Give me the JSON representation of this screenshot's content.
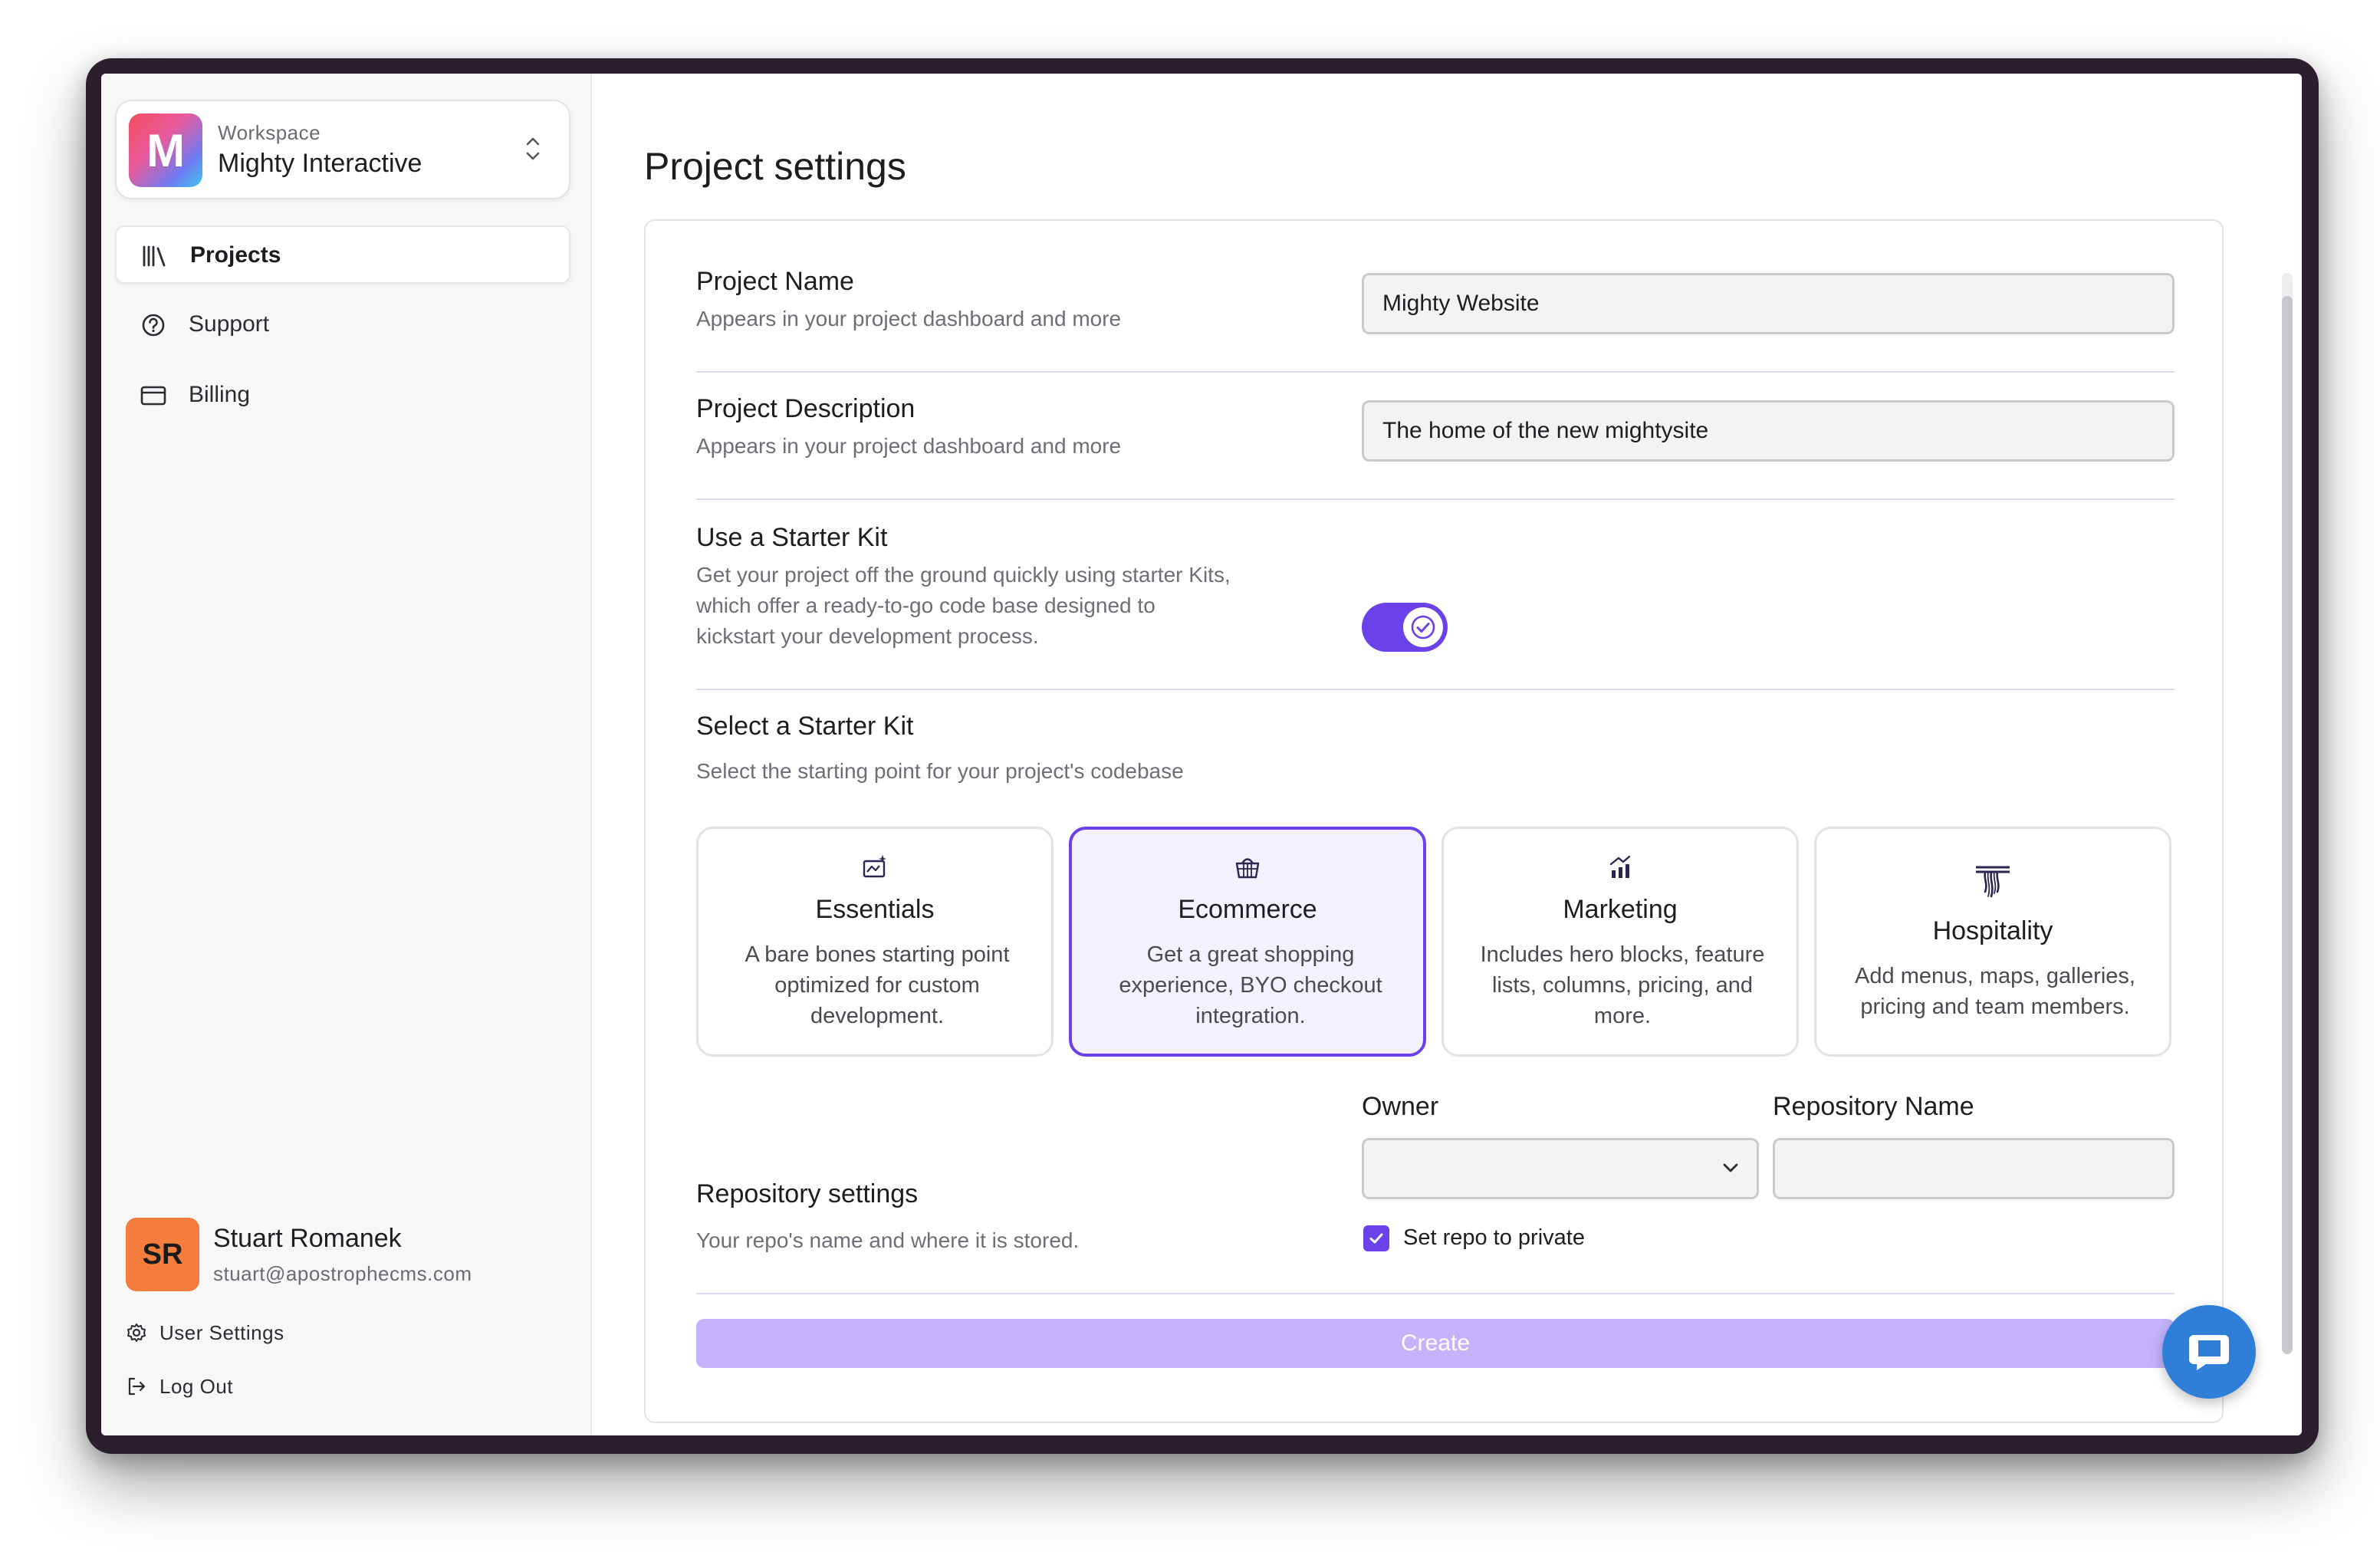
{
  "workspace": {
    "caption": "Workspace",
    "name": "Mighty Interactive",
    "logo_letter": "M"
  },
  "nav": {
    "items": [
      {
        "label": "Projects",
        "icon": "library-icon",
        "active": true
      },
      {
        "label": "Support",
        "icon": "help-circle-icon",
        "active": false
      },
      {
        "label": "Billing",
        "icon": "credit-card-icon",
        "active": false
      }
    ]
  },
  "user": {
    "initials": "SR",
    "name": "Stuart Romanek",
    "email": "stuart@apostrophecms.com",
    "settings_label": "User Settings",
    "logout_label": "Log Out"
  },
  "page": {
    "title": "Project settings"
  },
  "form": {
    "project_name": {
      "title": "Project Name",
      "description": "Appears in your project dashboard and more",
      "value": "Mighty Website"
    },
    "project_description": {
      "title": "Project Description",
      "description": "Appears in your project dashboard and more",
      "value": "The home of the new mightysite"
    },
    "starter_kit_toggle": {
      "title": "Use a Starter Kit",
      "description_lines": [
        "Get your project off the ground quickly using starter Kits,",
        "which offer a ready-to-go code base designed to",
        "kickstart your development process."
      ],
      "enabled": true
    },
    "select_kit": {
      "title": "Select a Starter Kit",
      "description": "Select the starting point for your project's codebase",
      "kits": [
        {
          "title": "Essentials",
          "icon": "sparkle-board-icon",
          "selected": false,
          "desc": [
            "A bare bones starting point",
            "optimized for custom",
            "development."
          ]
        },
        {
          "title": "Ecommerce",
          "icon": "shopping-basket-icon",
          "selected": true,
          "desc": [
            "Get a great shopping",
            "experience, BYO checkout",
            "integration."
          ]
        },
        {
          "title": "Marketing",
          "icon": "chart-up-icon",
          "selected": false,
          "desc": [
            "Includes hero blocks, feature",
            "lists, columns, pricing, and",
            "more."
          ]
        },
        {
          "title": "Hospitality",
          "icon": "hospitality-icon",
          "selected": false,
          "desc": [
            "Add menus, maps, galleries,",
            "pricing and team members."
          ]
        }
      ]
    },
    "repository": {
      "title": "Repository settings",
      "description": "Your repo's name and where it is stored.",
      "owner_label": "Owner",
      "owner_value": "",
      "repo_name_label": "Repository Name",
      "repo_name_value": "",
      "private_label": "Set repo to private",
      "private_checked": true
    },
    "create_label": "Create"
  },
  "colors": {
    "accent": "#6b41ea",
    "button_disabled": "#c3b3fb",
    "chat": "#2f7fd8",
    "avatar": "#f47c3c"
  }
}
